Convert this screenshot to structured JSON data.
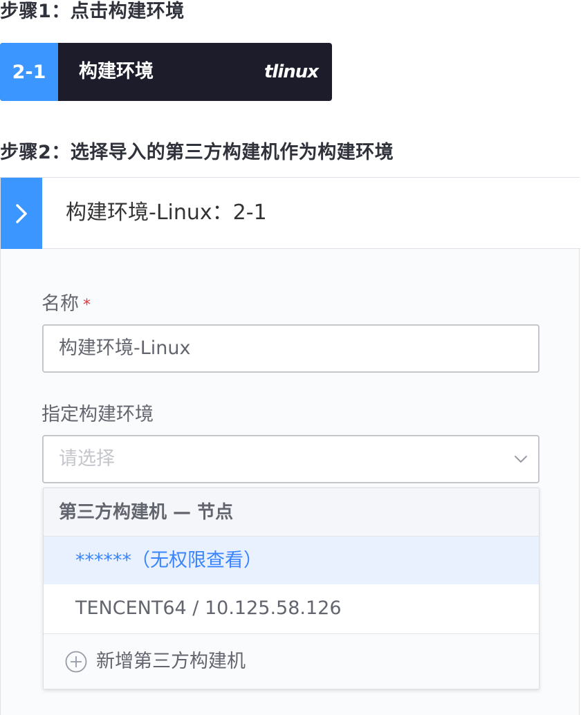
{
  "step1": {
    "title": "步骤1：点击构建环境",
    "atom": {
      "index": "2-1",
      "name": "构建环境",
      "logo_text": "tlinux",
      "accent_color": "#3c96ff",
      "background_color": "#1c1c2b"
    }
  },
  "step2": {
    "title": "步骤2：选择导入的第三方构建机作为构建环境",
    "panel": {
      "toggle_icon": "chevron-right-icon",
      "title": "构建环境-Linux：2-1",
      "name_field": {
        "label": "名称",
        "required_mark": "*",
        "value": "构建环境-Linux"
      },
      "env_field": {
        "label": "指定构建环境",
        "placeholder": "请选择",
        "icon": "chevron-down-icon"
      },
      "dropdown": {
        "group_label": "第三方构建机 — 节点",
        "options": [
          {
            "label": "******（无权限查看）",
            "highlighted": true
          },
          {
            "label": "TENCENT64 / 10.125.58.126",
            "highlighted": false
          }
        ],
        "footer_icon": "plus-circle-icon",
        "footer_label": "新增第三方构建机"
      }
    }
  }
}
